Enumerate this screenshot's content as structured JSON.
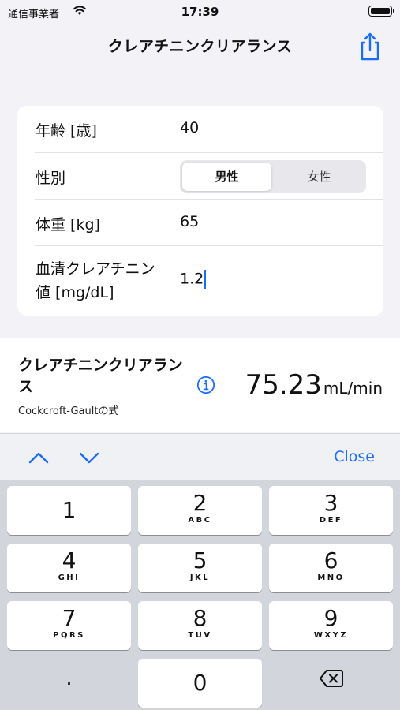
{
  "status_bar": {
    "carrier": "通信事業者",
    "time": "17:39"
  },
  "nav": {
    "title": "クレアチニンクリアランス",
    "share_icon": "share-icon"
  },
  "form": {
    "age": {
      "label": "年齢 [歳]",
      "value": "40"
    },
    "sex": {
      "label": "性別",
      "options": [
        "男性",
        "女性"
      ],
      "selected": "男性"
    },
    "weight": {
      "label": "体重 [kg]",
      "value": "65"
    },
    "creatinine": {
      "label_line1": "血清クレアチニン",
      "label_line2": "値 [mg/dL]",
      "value": "1.2"
    }
  },
  "result": {
    "title": "クレアチニンクリアランス",
    "subtitle": "Cockcroft-Gaultの式",
    "value": "75.23",
    "unit": "mL/min"
  },
  "toolbar": {
    "close_label": "Close"
  },
  "keypad": {
    "keys": [
      {
        "number": "1",
        "letters": ""
      },
      {
        "number": "2",
        "letters": "ABC"
      },
      {
        "number": "3",
        "letters": "DEF"
      },
      {
        "number": "4",
        "letters": "GHI"
      },
      {
        "number": "5",
        "letters": "JKL"
      },
      {
        "number": "6",
        "letters": "MNO"
      },
      {
        "number": "7",
        "letters": "PQRS"
      },
      {
        "number": "8",
        "letters": "TUV"
      },
      {
        "number": "9",
        "letters": "WXYZ"
      },
      {
        "number": "0",
        "letters": ""
      }
    ],
    "decimal": "."
  },
  "colors": {
    "accent": "#1b6ef3",
    "background": "#f2f2f7",
    "keypad": "#d3d5dc"
  }
}
